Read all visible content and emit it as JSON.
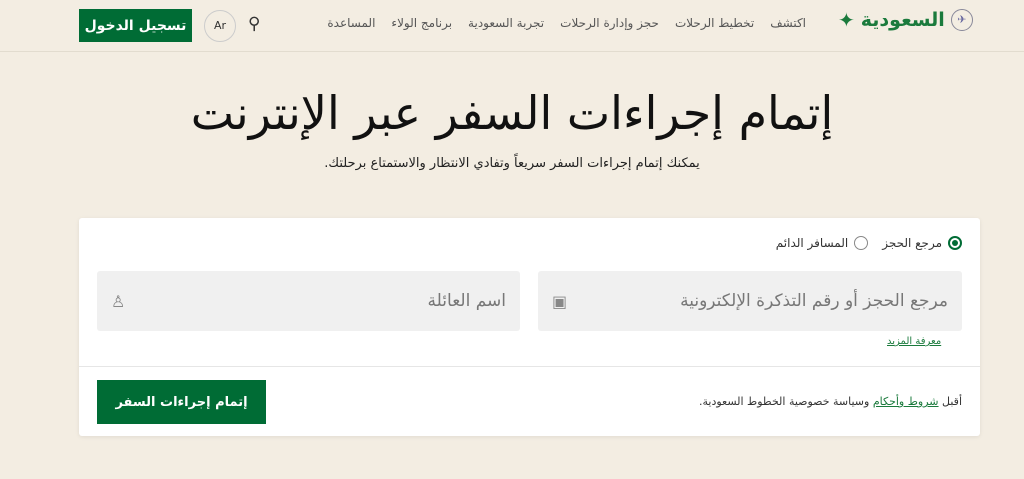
{
  "header": {
    "logo_text": "السعودية",
    "nav": [
      "اكتشف",
      "تخطيط الرحلات",
      "حجز وإدارة الرحلات",
      "تجربة السعودية",
      "برنامج الولاء",
      "المساعدة"
    ],
    "lang": "Ar",
    "login": "تسجيل الدخول"
  },
  "hero": {
    "title": "إتمام إجراءات السفر عبر الإنترنت",
    "subtitle": "يمكنك إتمام إجراءات السفر سريعاً وتفادي الانتظار والاستمتاع برحلتك."
  },
  "form": {
    "radio_booking": "مرجع الحجز",
    "radio_frequent": "المسافر الدائم",
    "booking_placeholder": "مرجع الحجز أو رقم التذكرة الإلكترونية",
    "lastname_placeholder": "اسم العائلة",
    "learn_more": "معرفة المزيد",
    "terms_prefix": "أقبل",
    "terms_link": "شروط وأحكام",
    "terms_suffix": "وسياسة خصوصية الخطوط السعودية.",
    "submit": "إتمام إجراءات السفر"
  }
}
